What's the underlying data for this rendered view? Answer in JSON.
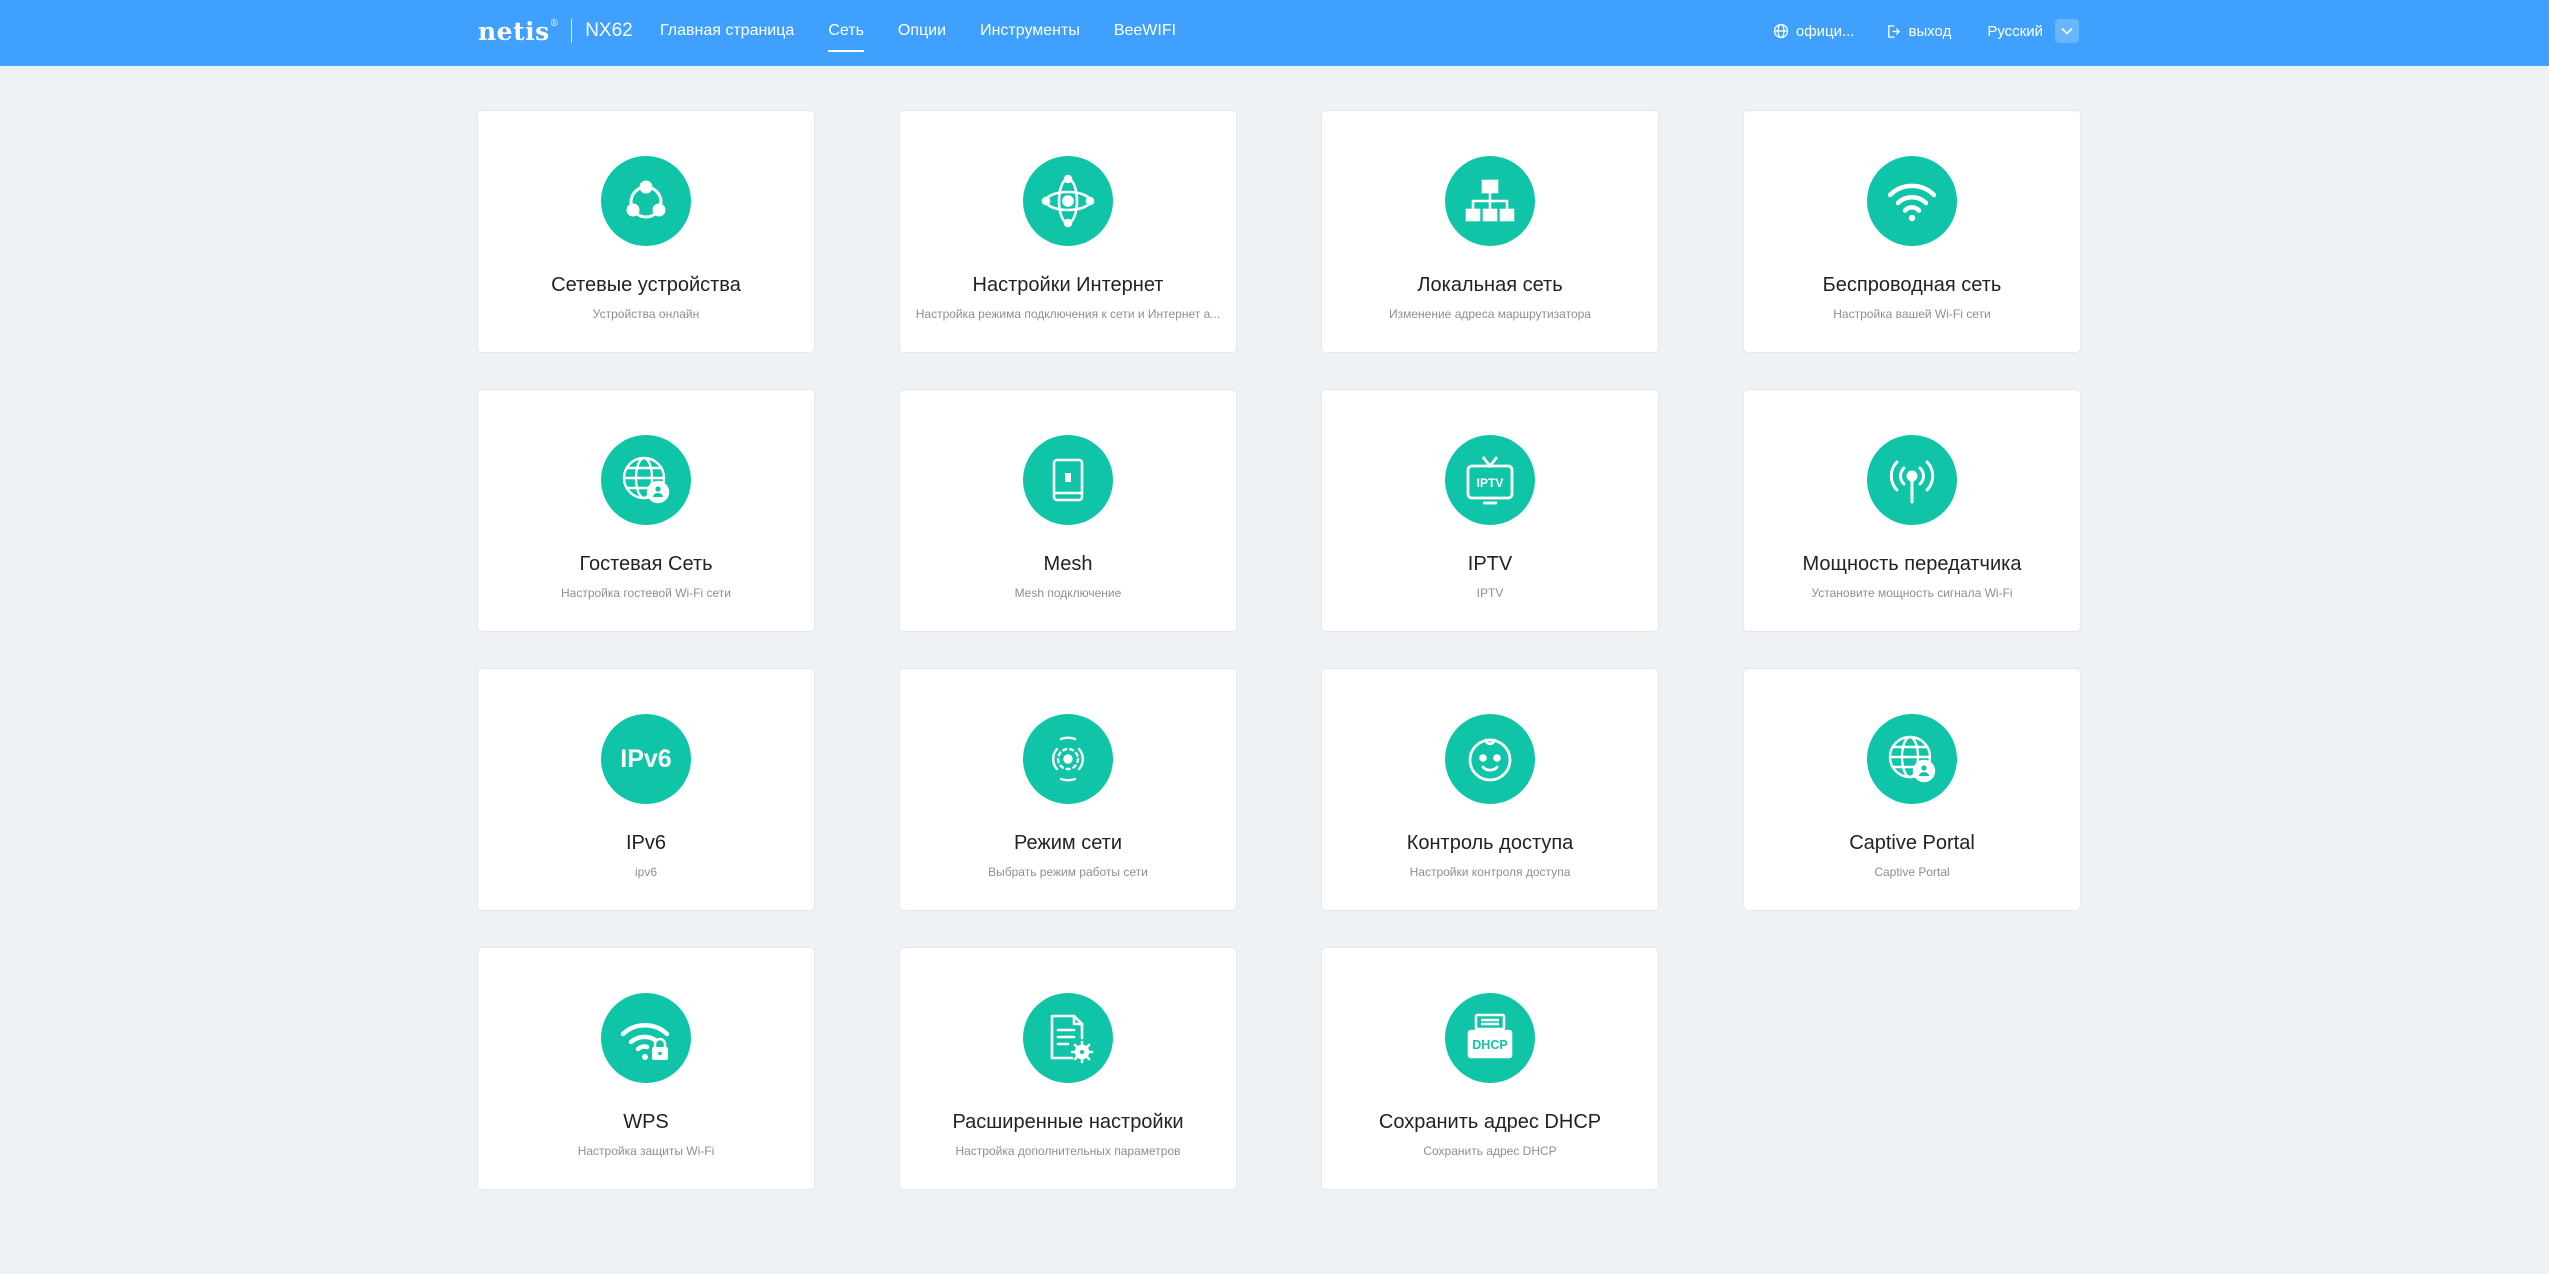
{
  "header": {
    "logo": "netis",
    "logo_mark": "®",
    "model": "NX62",
    "nav": [
      "Главная страница",
      "Сеть",
      "Опции",
      "Инструменты",
      "BeeWIFI"
    ],
    "active_nav": "Сеть",
    "official_label": "офици...",
    "logout_label": "выход",
    "language": "Русский"
  },
  "cards": [
    {
      "title": "Сетевые устройства",
      "subtitle": "Устройства онлайн",
      "icon": "network-devices-icon"
    },
    {
      "title": "Настройки Интернет",
      "subtitle": "Настройка режима подключения к сети и Интернет а...",
      "icon": "internet-settings-icon"
    },
    {
      "title": "Локальная сеть",
      "subtitle": "Изменение адреса маршрутизатора",
      "icon": "lan-icon"
    },
    {
      "title": "Беспроводная сеть",
      "subtitle": "Настройка вашей Wi-Fi сети",
      "icon": "wifi-icon"
    },
    {
      "title": "Гостевая Сеть",
      "subtitle": "Настройка гостевой Wi-Fi сети",
      "icon": "guest-network-icon"
    },
    {
      "title": "Mesh",
      "subtitle": "Mesh подключение",
      "icon": "mesh-icon"
    },
    {
      "title": "IPTV",
      "subtitle": "IPTV",
      "icon": "iptv-icon"
    },
    {
      "title": "Мощность передатчика",
      "subtitle": "Установите мощность сигнала Wi-Fi",
      "icon": "transmit-power-icon"
    },
    {
      "title": "IPv6",
      "subtitle": "ipv6",
      "icon": "ipv6-icon"
    },
    {
      "title": "Режим сети",
      "subtitle": "Выбрать режим работы сети",
      "icon": "network-mode-icon"
    },
    {
      "title": "Контроль доступа",
      "subtitle": "Настройки контроля доступа",
      "icon": "access-control-icon"
    },
    {
      "title": "Captive Portal",
      "subtitle": "Captive Portal",
      "icon": "captive-portal-icon"
    },
    {
      "title": "WPS",
      "subtitle": "Настройка защиты Wi-Fi",
      "icon": "wps-icon"
    },
    {
      "title": "Расширенные настройки",
      "subtitle": "Настройка дополнительных параметров",
      "icon": "advanced-settings-icon"
    },
    {
      "title": "Сохранить адрес DHCP",
      "subtitle": "Сохранить адрес DHCP",
      "icon": "dhcp-reservation-icon"
    }
  ],
  "icon_text": {
    "iptv": "IPTV",
    "ipv6": "IPv6",
    "dhcp": "DHCP"
  },
  "colors": {
    "header": "#3fa0fd",
    "accent": "#0fc4a7",
    "background": "#eff2f5"
  }
}
